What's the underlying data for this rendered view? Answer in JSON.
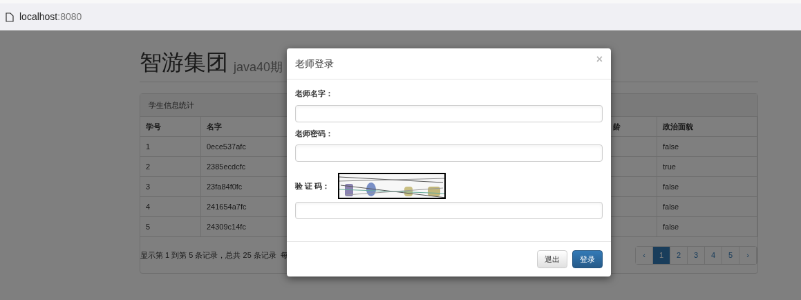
{
  "browser": {
    "host": "localhost",
    "port": ":8080"
  },
  "page": {
    "title": "智游集团",
    "subtitle": "java40期"
  },
  "panel": {
    "title": "学生信息统计",
    "columns": [
      "学号",
      "名字",
      "龄",
      "政治面貌"
    ],
    "rows": [
      {
        "id": "1",
        "name": "0ece537afc",
        "politics": "false"
      },
      {
        "id": "2",
        "name": "2385ecdcfc",
        "politics": "true"
      },
      {
        "id": "3",
        "name": "23fa84f0fc",
        "politics": "false"
      },
      {
        "id": "4",
        "name": "241654a7fc",
        "politics": "false"
      },
      {
        "id": "5",
        "name": "24309c14fc",
        "politics": "false"
      }
    ],
    "summary": "显示第 1 到第 5 条记录，总共 25 条记录  每",
    "pagination": [
      {
        "label": "‹",
        "selected": false
      },
      {
        "label": "1",
        "selected": true
      },
      {
        "label": "2",
        "selected": false
      },
      {
        "label": "3",
        "selected": false
      },
      {
        "label": "4",
        "selected": false
      },
      {
        "label": "5",
        "selected": false
      },
      {
        "label": "›",
        "selected": false
      }
    ]
  },
  "modal": {
    "title": "老师登录",
    "close": "×",
    "fields": [
      {
        "kind": "text",
        "label": "老师名字："
      },
      {
        "kind": "password",
        "label": "老师密码："
      },
      {
        "kind": "captcha",
        "label": "验 证 码："
      }
    ],
    "buttons": [
      {
        "label": "退出",
        "kind": "default"
      },
      {
        "label": "登录",
        "kind": "primary"
      }
    ]
  }
}
